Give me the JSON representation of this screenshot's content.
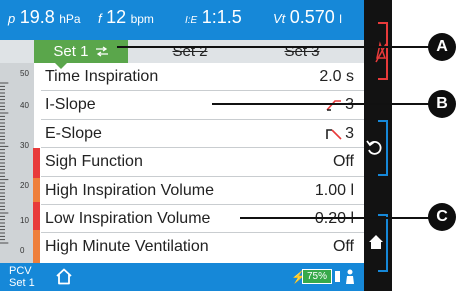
{
  "status": {
    "pressure": {
      "symbol": "p",
      "value": "19.8",
      "unit": "hPa"
    },
    "frequency": {
      "symbol": "f",
      "value": "12",
      "unit": "bpm"
    },
    "ie_ratio": {
      "symbol": "I:E",
      "value": "1:1.5"
    },
    "volume": {
      "symbol": "Vt",
      "value": "0.570",
      "unit": "l"
    }
  },
  "tabs": [
    {
      "label": "Set 1",
      "state": "active"
    },
    {
      "label": "Set 2",
      "state": "inactive"
    },
    {
      "label": "Set 3",
      "state": "inactive"
    }
  ],
  "gauge": {
    "labels": [
      "50",
      "40",
      "30",
      "20",
      "10",
      "0"
    ]
  },
  "parameters": [
    {
      "name": "Time Inspiration",
      "value": "2.0 s"
    },
    {
      "name": "I-Slope",
      "value": "3",
      "icon": "rising-slope-icon"
    },
    {
      "name": "E-Slope",
      "value": "3",
      "icon": "falling-slope-icon"
    },
    {
      "name": "Sigh Function",
      "value": "Off"
    },
    {
      "name": "High Inspiration Volume",
      "value": "1.00 l"
    },
    {
      "name": "Low Inspiration Volume",
      "value": "0.20 l"
    },
    {
      "name": "High Minute Ventilation",
      "value": "Off"
    }
  ],
  "bottom": {
    "mode_line1": "PCV",
    "mode_line2": "Set 1",
    "battery": "75%"
  },
  "right_panel": [
    "alarm-mute-icon",
    "rotate-icon",
    "home-icon"
  ],
  "callouts": [
    "A",
    "B",
    "C"
  ],
  "colors": {
    "status_bar": "#1688d8",
    "active_tab": "#5aa64b",
    "alarm_red": "#e83a3a",
    "orange": "#ee7f3b",
    "panel": "#121212"
  }
}
